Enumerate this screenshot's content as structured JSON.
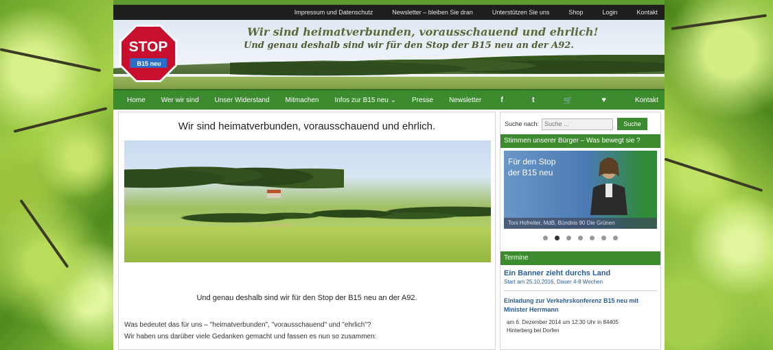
{
  "topbar": {
    "links": [
      "Impressum und Datenschutz",
      "Newsletter – bleiben Sie dran",
      "Unterstützen Sie uns",
      "Shop",
      "Login",
      "Kontakt"
    ]
  },
  "header": {
    "stop_text": "STOP",
    "stop_badge": "B15 neu",
    "slogan_line1": "Wir sind heimatverbunden, vorausschauend und ehrlich!",
    "slogan_line2": "Und genau deshalb sind wir für den Stop der B15 neu an der A92."
  },
  "nav": {
    "items": [
      "Home",
      "Wer wir sind",
      "Unser Widerstand",
      "Mitmachen",
      "Infos zur B15 neu ⌄",
      "Presse",
      "Newsletter"
    ],
    "icons": [
      "f",
      "t",
      "cart",
      "heart"
    ],
    "icon_glyphs": [
      "f",
      "t",
      "🛒",
      "♥"
    ],
    "last": "Kontakt"
  },
  "main": {
    "title": "Wir sind heimatverbunden, vorausschauend und ehrlich.",
    "subtitle": "Und genau deshalb sind wir für den Stop der B15 neu an der A92.",
    "para_line1": "Was bedeutet das für uns – \"heimatverbunden\", \"vorausschauend\" und \"ehrlich\"?",
    "para_line2": "Wir haben uns darüber viele Gedanken gemacht und fassen es nun so zusammen:"
  },
  "sidebar": {
    "search_label": "Suche nach:",
    "search_placeholder": "Suche ...",
    "search_button": "Suche",
    "voices_head": "Stimmen unserer Bürger – Was bewegt sie ?",
    "video_title_line1": "Für den Stop",
    "video_title_line2": "der B15 neu",
    "video_caption": "Toni Hofreiter, MdB, Bündnis 90 Die Grünen",
    "slider_dots": 7,
    "slider_active": 1,
    "termine_head": "Termine",
    "event1_title": "Ein Banner zieht durchs Land",
    "event1_sub": "Start am 25.10.2016, Dauer 4-8 Wochen",
    "event2_title_line1": "Einladung zur Verkehrskonferenz B15 neu mit",
    "event2_title_line2": "Minister Herrmann",
    "event2_sub_line1": "am 6. Dezember 2014 um 12:30 Uhr in 84405",
    "event2_sub_line2": "Hinterberg bei Dorfen"
  },
  "colors": {
    "nav_green": "#3d8b2f",
    "topbar_dark": "#1e1e1e",
    "link_blue": "#2a5d96",
    "stop_red": "#c8102e"
  }
}
